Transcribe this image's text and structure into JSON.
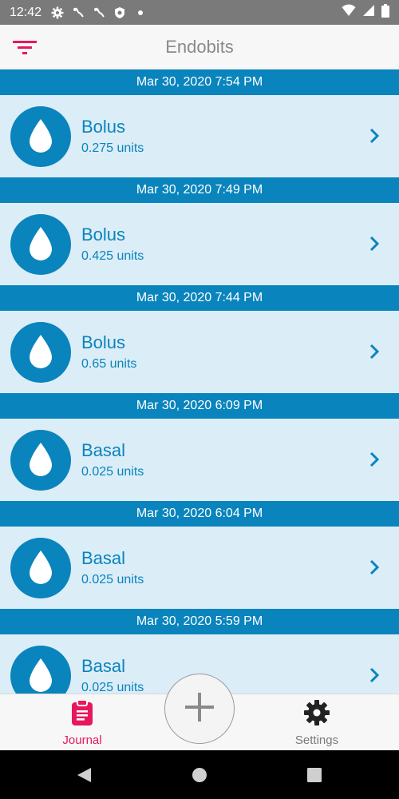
{
  "status_bar": {
    "time": "12:42",
    "icons": [
      "gear-icon",
      "sprout-icon",
      "sprout-icon",
      "shield-icon",
      "dot-icon"
    ],
    "right_icons": [
      "wifi-icon",
      "signal-icon",
      "battery-icon"
    ]
  },
  "app_bar": {
    "title": "Endobits",
    "filter_icon": "filter-icon"
  },
  "colors": {
    "accent": "#0a84bd",
    "card_bg": "#dbedf7",
    "brand_pink": "#e8175d"
  },
  "entries": [
    {
      "date": "Mar 30, 2020 7:54 PM",
      "type": "Bolus",
      "amount": "0.275 units"
    },
    {
      "date": "Mar 30, 2020 7:49 PM",
      "type": "Bolus",
      "amount": "0.425 units"
    },
    {
      "date": "Mar 30, 2020 7:44 PM",
      "type": "Bolus",
      "amount": "0.65 units"
    },
    {
      "date": "Mar 30, 2020 6:09 PM",
      "type": "Basal",
      "amount": "0.025 units"
    },
    {
      "date": "Mar 30, 2020 6:04 PM",
      "type": "Basal",
      "amount": "0.025 units"
    },
    {
      "date": "Mar 30, 2020 5:59 PM",
      "type": "Basal",
      "amount": "0.025 units"
    }
  ],
  "bottom_nav": {
    "journal_label": "Journal",
    "settings_label": "Settings",
    "add_icon": "plus-icon"
  }
}
